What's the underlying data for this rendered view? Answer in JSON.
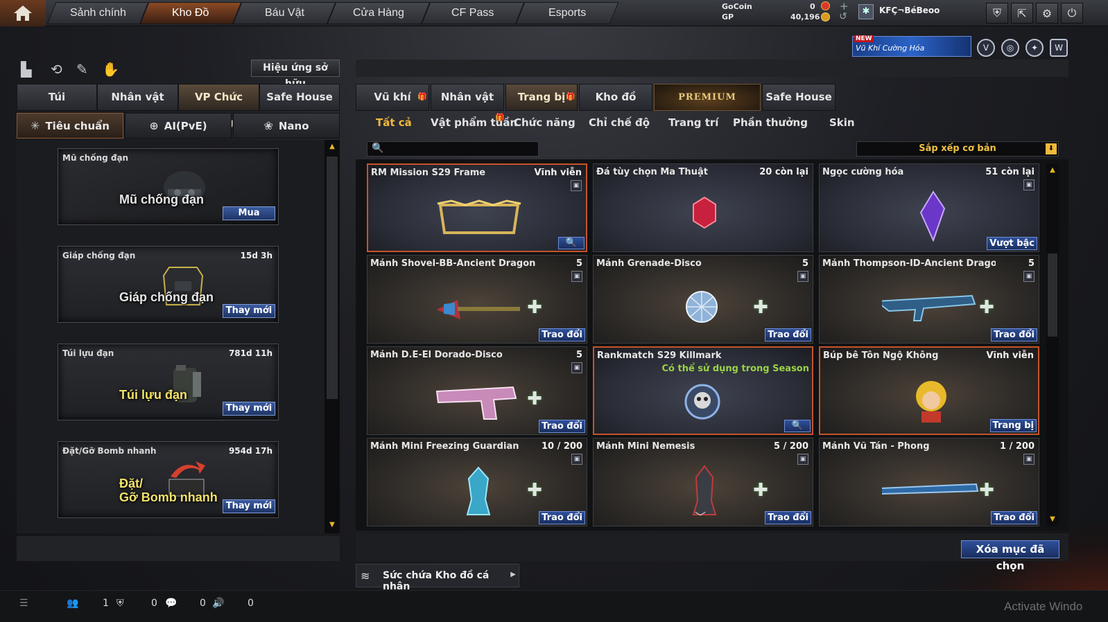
{
  "topbar": {
    "tabs": [
      "Sảnh chính",
      "Kho Đồ",
      "Báu Vật",
      "Cửa Hàng",
      "CF Pass",
      "Esports"
    ],
    "active_tab": "Kho Đồ",
    "gocoin_label": "GoCoin",
    "gocoin_value": "0",
    "gp_label": "GP",
    "gp_value": "40,196",
    "username": "KFÇ¬BéBeoo",
    "icons": [
      "shield-icon",
      "exit-icon",
      "gear-icon",
      "power-icon"
    ]
  },
  "promo": {
    "new_label": "NEW",
    "text": "Vũ Khí Cường Hóa"
  },
  "left": {
    "effect_button": "Hiệu ứng sở hữu",
    "tabs": [
      "Túi",
      "Nhân vật",
      "VP Chức năng",
      "Safe House"
    ],
    "active_tab": "VP Chức năng",
    "subtabs": [
      "Tiêu chuẩn",
      "AI(PvE)",
      "Nano"
    ],
    "active_subtab": "Tiêu chuẩn",
    "slots": [
      {
        "name": "Mũ chống đạn",
        "time": "",
        "big": "Mũ chống đạn",
        "button": "Mua"
      },
      {
        "name": "Giáp chống đạn",
        "time": "15d 3h",
        "big": "Giáp chống đạn",
        "button": "Thay mới"
      },
      {
        "name": "Túi lựu đạn",
        "time": "781d 11h",
        "big": "Túi lựu đạn",
        "button": "Thay mới"
      },
      {
        "name": "Đặt/Gỡ Bomb nhanh",
        "time": "954d 17h",
        "big1": "Đặt/",
        "big2": "Gỡ Bomb nhanh",
        "button": "Thay mới"
      }
    ]
  },
  "right": {
    "tabs": [
      "Vũ khí",
      "Nhân vật",
      "Trang bị",
      "Kho đồ",
      "PREMIUM",
      "Safe House"
    ],
    "active_tab": "Trang bị",
    "categories": [
      "Tất cả",
      "Vật phẩm tuần",
      "Chức năng",
      "Chỉ chế độ",
      "Trang trí",
      "Phần thưởng",
      "Skin"
    ],
    "active_category": "Tất cả",
    "sort_label": "Sắp xếp cơ bản",
    "items": [
      {
        "name": "RM Mission S29 Frame",
        "qty": "Vĩnh viễn",
        "action": "",
        "note": ""
      },
      {
        "name": "Đá tùy chọn Ma Thuật",
        "qty": "20 còn lại",
        "action": "",
        "note": ""
      },
      {
        "name": "Ngọc cường hóa",
        "qty": "51 còn lại",
        "action": "Vượt bậc",
        "note": ""
      },
      {
        "name": "Mảnh Shovel-BB-Ancient Dragon",
        "qty": "5",
        "action": "Trao đổi",
        "note": ""
      },
      {
        "name": "Mảnh Grenade-Disco",
        "qty": "5",
        "action": "Trao đổi",
        "note": ""
      },
      {
        "name": "Mảnh Thompson-ID-Ancient Dragon",
        "qty": "5",
        "action": "Trao đổi",
        "note": ""
      },
      {
        "name": "Mảnh D.E-El Dorado-Disco",
        "qty": "5",
        "action": "Trao đổi",
        "note": ""
      },
      {
        "name": "Rankmatch S29 Killmark",
        "qty": "",
        "action": "",
        "note": "Có thể sử dụng trong Season"
      },
      {
        "name": "Búp bê Tôn Ngộ Không",
        "qty": "Vĩnh viễn",
        "action": "Trang bị",
        "note": ""
      },
      {
        "name": "Mảnh Mini Freezing Guardian",
        "qty": "10 / 200",
        "action": "Trao đổi",
        "note": ""
      },
      {
        "name": "Mảnh Mini Nemesis",
        "qty": "5 / 200",
        "action": "Trao đổi",
        "note": ""
      },
      {
        "name": "Mảnh Vũ Tán - Phong",
        "qty": "1 / 200",
        "action": "Trao đổi",
        "note": ""
      }
    ],
    "delete_button": "Xóa mục đã chọn",
    "capacity_label": "Sức chứa Kho đồ cá nhân"
  },
  "bottombar": {
    "friends": "1",
    "clan": "0",
    "chat": "0",
    "voice": "0"
  },
  "watermark": "Activate Windo"
}
